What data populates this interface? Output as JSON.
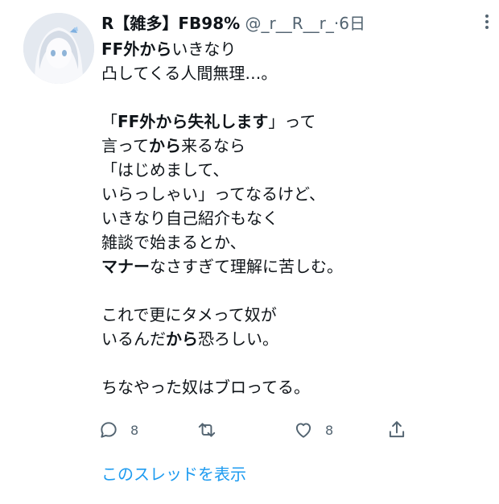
{
  "tweet": {
    "author_name": "R【雑多】FB98%",
    "handle": "@_r__R__r_",
    "separator": "·",
    "time": "6日",
    "body_lines": [
      [
        {
          "t": "FF外から",
          "b": true
        },
        {
          "t": "いきなり",
          "b": false
        }
      ],
      [
        {
          "t": "凸してくる人間無理…。",
          "b": false
        }
      ],
      [],
      [
        {
          "t": "「",
          "b": false
        },
        {
          "t": "FF外から失礼します",
          "b": true
        },
        {
          "t": "」って",
          "b": false
        }
      ],
      [
        {
          "t": "言って",
          "b": false
        },
        {
          "t": "から",
          "b": true
        },
        {
          "t": "来るなら",
          "b": false
        }
      ],
      [
        {
          "t": "「はじめまして、",
          "b": false
        }
      ],
      [
        {
          "t": "いらっしゃい」ってなるけど、",
          "b": false
        }
      ],
      [
        {
          "t": "いきなり自己紹介もなく",
          "b": false
        }
      ],
      [
        {
          "t": "雑談で始まるとか、",
          "b": false
        }
      ],
      [
        {
          "t": "マナー",
          "b": true
        },
        {
          "t": "なさすぎて理解に苦しむ。",
          "b": false
        }
      ],
      [],
      [
        {
          "t": "これで更にタメって奴が",
          "b": false
        }
      ],
      [
        {
          "t": "いるんだ",
          "b": false
        },
        {
          "t": "から",
          "b": true
        },
        {
          "t": "恐ろしい。",
          "b": false
        }
      ],
      [],
      [
        {
          "t": "ちなやった奴はブロってる。",
          "b": false
        }
      ]
    ],
    "actions": {
      "reply": {
        "icon": "reply-icon",
        "count": "8"
      },
      "retweet": {
        "icon": "retweet-icon",
        "count": ""
      },
      "like": {
        "icon": "heart-icon",
        "count": "8"
      },
      "share": {
        "icon": "share-icon",
        "count": ""
      }
    },
    "show_thread_label": "このスレッドを表示"
  },
  "colors": {
    "text": "#0f1419",
    "secondary": "#536471",
    "link": "#1d9bf0"
  }
}
